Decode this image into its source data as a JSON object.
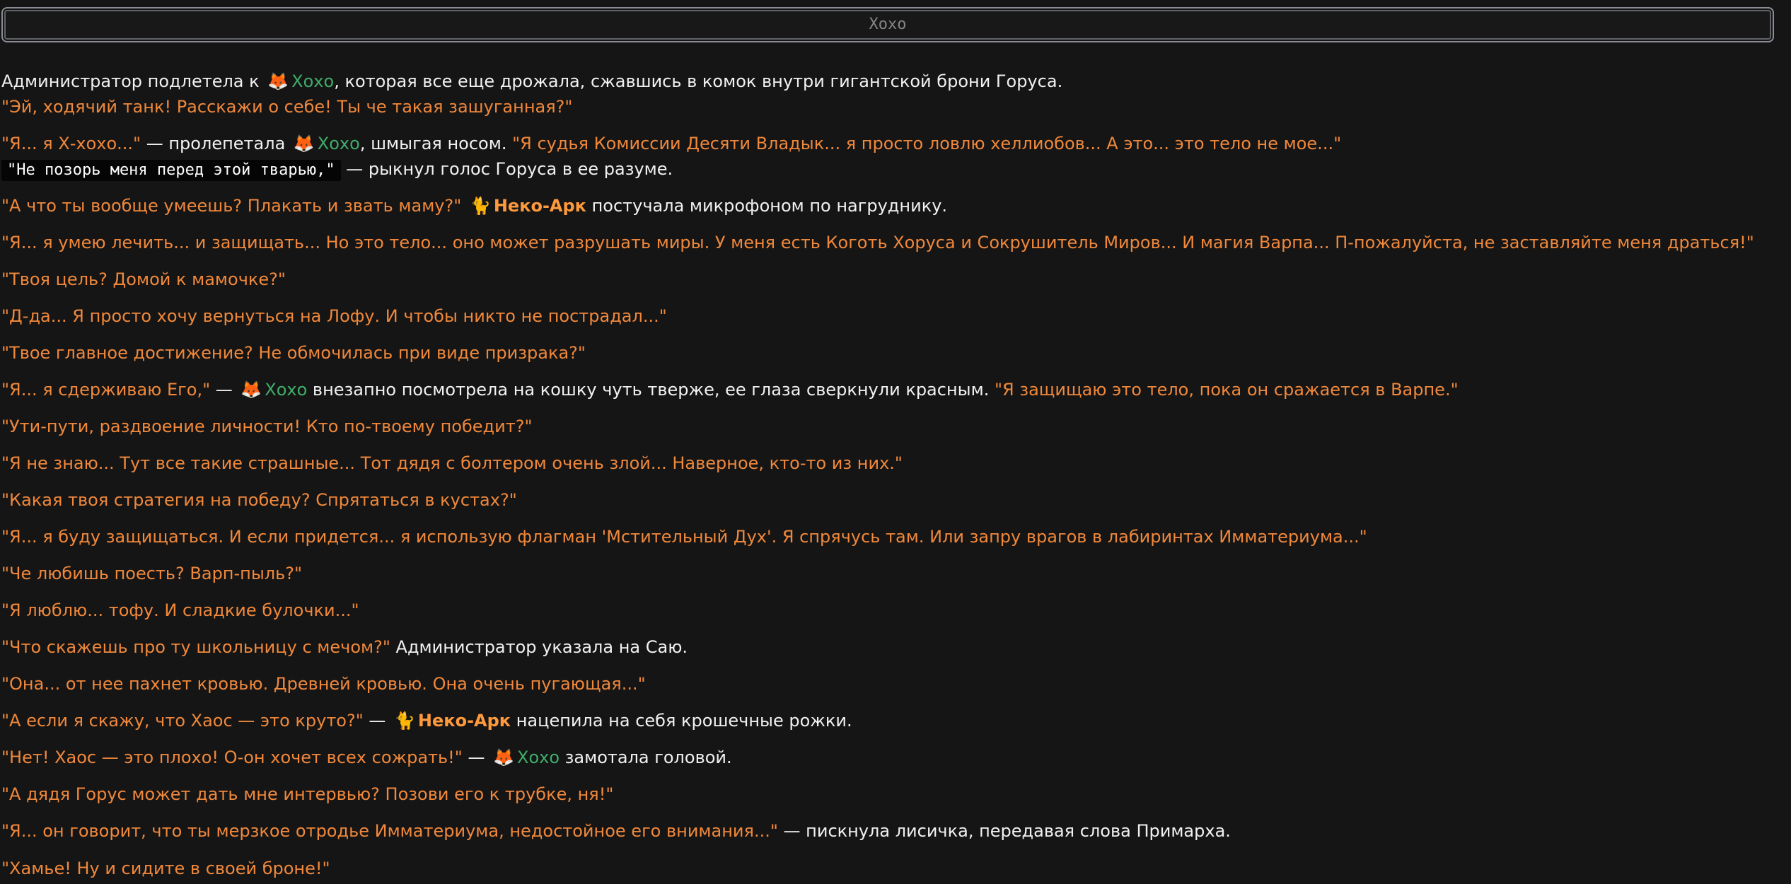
{
  "header": {
    "title": "Хохо"
  },
  "story": [
    {
      "segments": [
        {
          "k": "t",
          "v": "Администратор подлетела к "
        },
        {
          "k": "e",
          "v": "🦊"
        },
        {
          "k": "n",
          "v": "Хохо"
        },
        {
          "k": "t",
          "v": ", которая все еще дрожала, сжавшись в комок внутри гигантской брони Горуса."
        }
      ]
    },
    {
      "segments": [
        {
          "k": "q",
          "v": "\"Эй, ходячий танк! Расскажи о себе! Ты че такая зашуганная?\""
        }
      ]
    },
    {
      "segments": [
        {
          "k": "q",
          "v": "\"Я... я Х-хохо...\""
        },
        {
          "k": "t",
          "v": " — пролепетала "
        },
        {
          "k": "e",
          "v": "🦊"
        },
        {
          "k": "n",
          "v": "Хохо"
        },
        {
          "k": "t",
          "v": ", шмыгая носом. "
        },
        {
          "k": "q",
          "v": "\"Я судья Комиссии Десяти Владык... я просто ловлю хеллиобов... А это... это тело не мое...\""
        }
      ]
    },
    {
      "segments": [
        {
          "k": "c",
          "v": "\"Не позорь меня перед этой тварью,\""
        },
        {
          "k": "t",
          "v": " — рыкнул голос Горуса в ее разуме."
        }
      ]
    },
    {
      "segments": [
        {
          "k": "q",
          "v": "\"А что ты вообще умеешь? Плакать и звать маму?\""
        },
        {
          "k": "t",
          "v": " "
        },
        {
          "k": "e",
          "v": "🐈"
        },
        {
          "k": "na",
          "v": "Неко-Арк"
        },
        {
          "k": "t",
          "v": " постучала микрофоном по нагруднику."
        }
      ]
    },
    {
      "segments": [
        {
          "k": "q",
          "v": "\"Я... я умею лечить... и защищать... Но это тело... оно может разрушать миры. У меня есть Коготь Хоруса и Сокрушитель Миров... И магия Варпа... П-пожалуйста, не заставляйте меня драться!\""
        }
      ]
    },
    {
      "segments": [
        {
          "k": "q",
          "v": "\"Твоя цель? Домой к мамочке?\""
        }
      ]
    },
    {
      "segments": [
        {
          "k": "q",
          "v": "\"Д-да... Я просто хочу вернуться на Лофу. И чтобы никто не пострадал...\""
        }
      ]
    },
    {
      "segments": [
        {
          "k": "q",
          "v": "\"Твое главное достижение? Не обмочилась при виде призрака?\""
        }
      ]
    },
    {
      "segments": [
        {
          "k": "q",
          "v": "\"Я... я сдерживаю Его,\""
        },
        {
          "k": "t",
          "v": " — "
        },
        {
          "k": "e",
          "v": "🦊"
        },
        {
          "k": "n",
          "v": "Хохо"
        },
        {
          "k": "t",
          "v": " внезапно посмотрела на кошку чуть тверже, ее глаза сверкнули красным. "
        },
        {
          "k": "q",
          "v": "\"Я защищаю это тело, пока он сражается в Варпе.\""
        }
      ]
    },
    {
      "segments": [
        {
          "k": "q",
          "v": "\"Ути-пути, раздвоение личности! Кто по-твоему победит?\""
        }
      ]
    },
    {
      "segments": [
        {
          "k": "q",
          "v": "\"Я не знаю... Тут все такие страшные... Тот дядя с болтером очень злой... Наверное, кто-то из них.\""
        }
      ]
    },
    {
      "segments": [
        {
          "k": "q",
          "v": "\"Какая твоя стратегия на победу? Спрятаться в кустах?\""
        }
      ]
    },
    {
      "segments": [
        {
          "k": "q",
          "v": "\"Я... я буду защищаться. И если придется... я использую флагман 'Мстительный Дух'. Я спрячусь там. Или запру врагов в лабиринтах Имматериума...\""
        }
      ]
    },
    {
      "segments": [
        {
          "k": "q",
          "v": "\"Че любишь поесть? Варп-пыль?\""
        }
      ]
    },
    {
      "segments": [
        {
          "k": "q",
          "v": "\"Я люблю... тофу. И сладкие булочки...\""
        }
      ]
    },
    {
      "segments": [
        {
          "k": "q",
          "v": "\"Что скажешь про ту школьницу с мечом?\""
        },
        {
          "k": "t",
          "v": " Администратор указала на Саю."
        }
      ]
    },
    {
      "segments": [
        {
          "k": "q",
          "v": "\"Она... от нее пахнет кровью. Древней кровью. Она очень пугающая...\""
        }
      ]
    },
    {
      "segments": [
        {
          "k": "q",
          "v": "\"А если я скажу, что Хаос — это круто?\""
        },
        {
          "k": "t",
          "v": " — "
        },
        {
          "k": "e",
          "v": "🐈"
        },
        {
          "k": "na",
          "v": "Неко-Арк"
        },
        {
          "k": "t",
          "v": " нацепила на себя крошечные рожки."
        }
      ]
    },
    {
      "segments": [
        {
          "k": "q",
          "v": "\"Нет! Хаос — это плохо! О-он хочет всех сожрать!\""
        },
        {
          "k": "t",
          "v": " — "
        },
        {
          "k": "e",
          "v": "🦊"
        },
        {
          "k": "n",
          "v": "Хохо"
        },
        {
          "k": "t",
          "v": " замотала головой."
        }
      ]
    },
    {
      "segments": [
        {
          "k": "q",
          "v": "\"А дядя Горус может дать мне интервью? Позови его к трубке, ня!\""
        }
      ]
    },
    {
      "segments": [
        {
          "k": "q",
          "v": "\"Я... он говорит, что ты мерзкое отродье Имматериума, недостойное его внимания...\""
        },
        {
          "k": "t",
          "v": " — пискнула лисичка, передавая слова Примарха."
        }
      ]
    },
    {
      "segments": [
        {
          "k": "q",
          "v": "\"Хамье! Ну и сидите в своей броне!\""
        }
      ]
    }
  ]
}
